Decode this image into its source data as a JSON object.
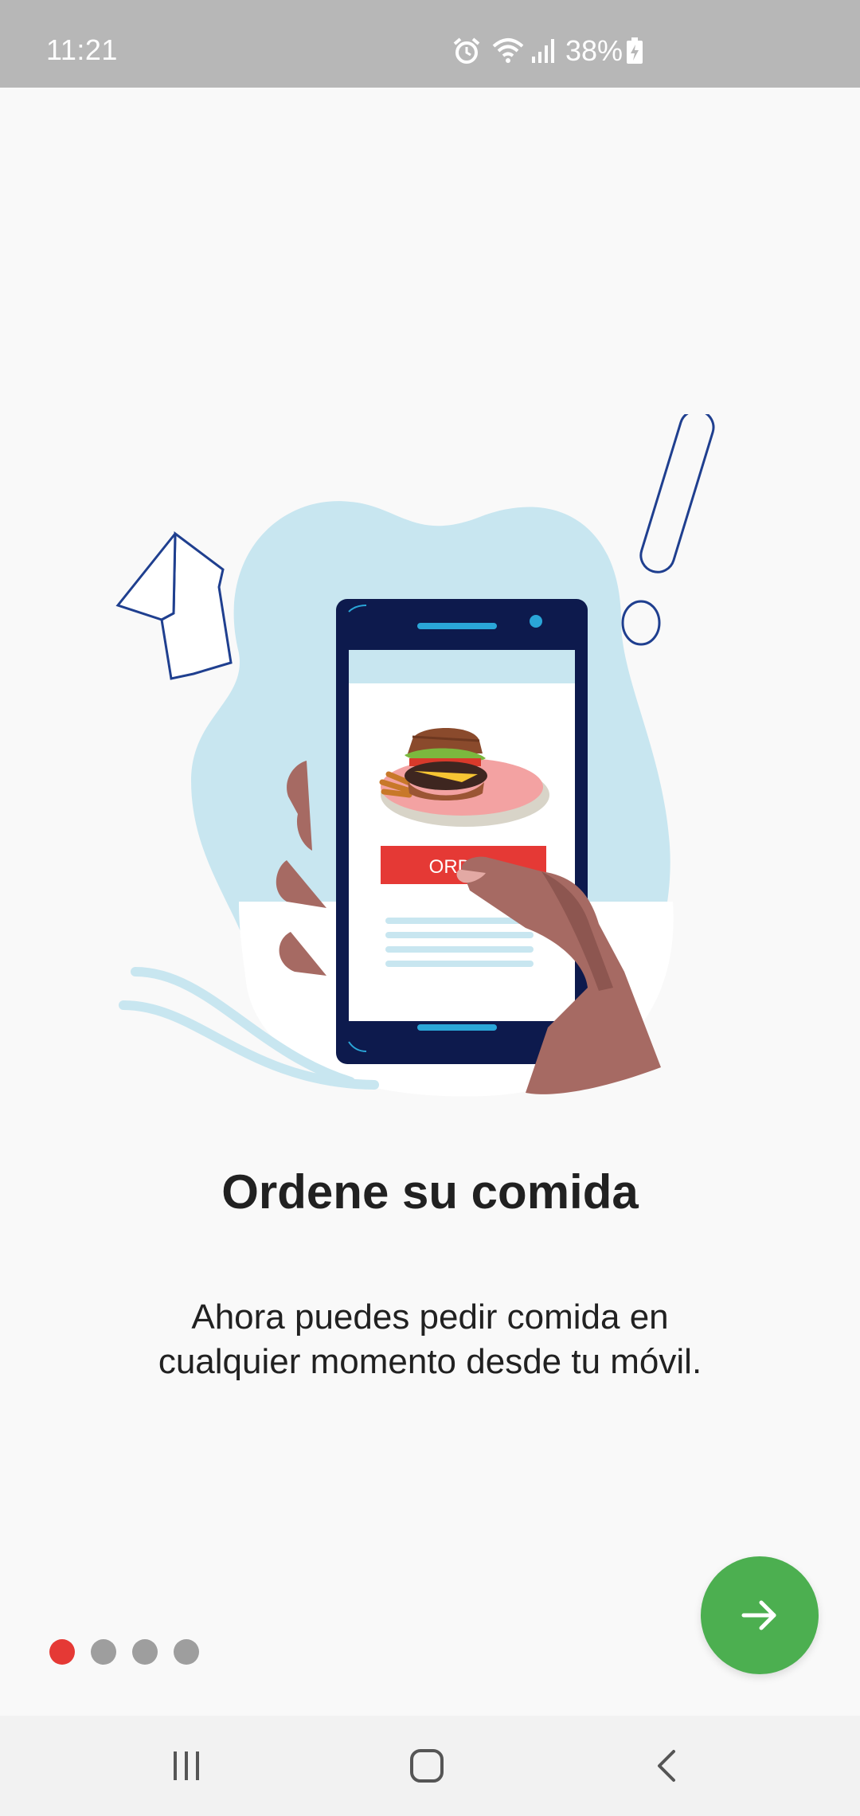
{
  "status_bar": {
    "time": "11:21",
    "battery": "38%",
    "icons": [
      "alarm-icon",
      "wifi-icon",
      "signal-icon",
      "battery-charging-icon"
    ]
  },
  "illustration": {
    "button_label": "ORDER"
  },
  "onboarding": {
    "title": "Ordene su comida",
    "description": "Ahora puedes pedir comida en cualquier momento desde tu móvil."
  },
  "pager": {
    "total": 4,
    "current": 1
  },
  "fab": {
    "icon": "arrow-right-icon"
  },
  "navigation": {
    "buttons": [
      "recent-apps-icon",
      "home-icon",
      "back-icon"
    ]
  },
  "colors": {
    "status_bar": "#b7b7b7",
    "accent_red": "#e53935",
    "fab_green": "#4caf50",
    "inactive_dot": "#9e9e9e"
  }
}
